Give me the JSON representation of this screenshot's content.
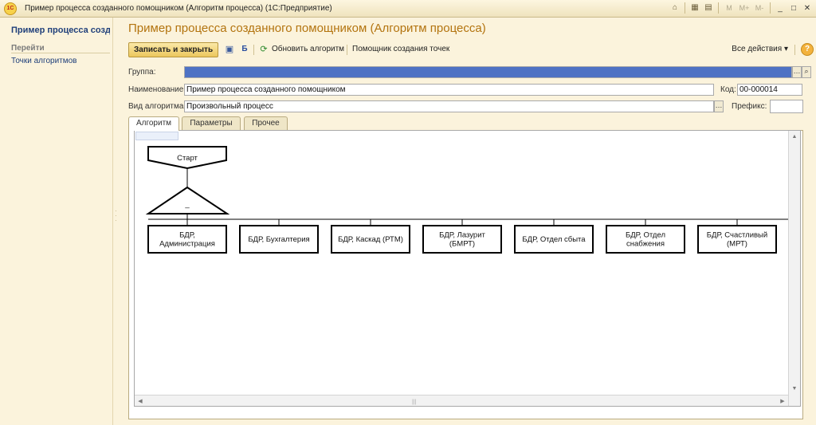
{
  "window": {
    "title": "Пример процесса созданного помощником (Алгоритм процесса)  (1С:Предприятие)",
    "logo": "1С",
    "controls": [
      "M",
      "M+",
      "M-"
    ]
  },
  "nav": {
    "active_item": "Пример процесса созданного помощником",
    "group_label": "Перейти",
    "links": [
      "Точки алгоритмов"
    ]
  },
  "form": {
    "title": "Пример процесса созданного помощником (Алгоритм процесса)",
    "toolbar": {
      "save_close": "Записать и закрыть",
      "refresh": "Обновить алгоритм",
      "wizard": "Помощник создания точек",
      "all_actions": "Все действия",
      "help": "?"
    },
    "fields": {
      "group": {
        "label": "Группа:",
        "value": ""
      },
      "name": {
        "label": "Наименование:",
        "value": "Пример процесса созданного помощником"
      },
      "code": {
        "label": "Код:",
        "value": "00-000014"
      },
      "kind": {
        "label": "Вид алгоритма:",
        "value": "Произвольный процесс"
      },
      "prefix": {
        "label": "Префикс:",
        "value": ""
      }
    },
    "tabs": [
      {
        "label": "Алгоритм",
        "active": true
      },
      {
        "label": "Параметры",
        "active": false
      },
      {
        "label": "Прочее",
        "active": false
      }
    ]
  },
  "diagram": {
    "start_label": "Старт",
    "branch_label": "_",
    "nodes": [
      [
        "БДР,",
        "Администрация"
      ],
      [
        "БДР, Бухгалтерия"
      ],
      [
        "БДР, Каскад (РТМ)"
      ],
      [
        "БДР, Лазурит",
        "(БМРТ)"
      ],
      [
        "БДР, Отдел сбыта"
      ],
      [
        "БДР, Отдел",
        "снабжения"
      ],
      [
        "БДР, Счастливый",
        "(МРТ)"
      ]
    ]
  },
  "colors": {
    "background": "#fbf3dc",
    "title_orange": "#b3740f",
    "link_blue": "#1f3f7a",
    "selection_blue": "#4e72c4",
    "primary_button": "#ecc75d"
  }
}
